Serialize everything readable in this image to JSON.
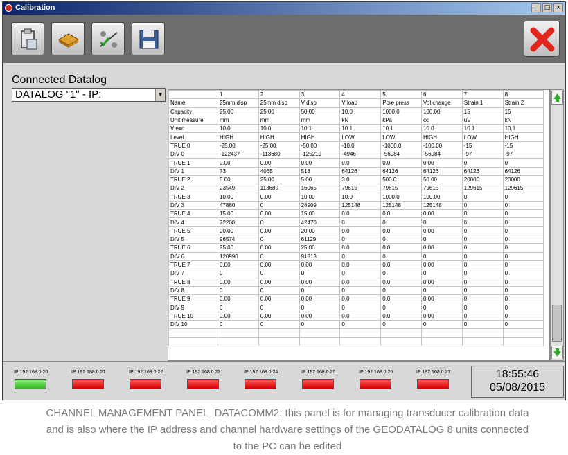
{
  "window": {
    "title": "Calibration",
    "buttons": [
      "_",
      "□",
      "×"
    ]
  },
  "toolbar": {
    "icons": [
      "clipboard-icon",
      "chip-icon",
      "network-icon",
      "floppy-disk-icon"
    ],
    "close_icon": "red-x-icon"
  },
  "connected": {
    "label": "Connected Datalog",
    "selected": "DATALOG \"1\" - IP:"
  },
  "grid": {
    "header": [
      "",
      "1",
      "2",
      "3",
      "4",
      "5",
      "6",
      "7",
      "8"
    ],
    "rows": [
      [
        "Name",
        "25mm disp",
        "25mm disp",
        "V disp",
        "V load",
        "Pore press",
        "Vol change",
        "Strain 1",
        "Strain 2"
      ],
      [
        "Capacity",
        "25.00",
        "25.00",
        "50.00",
        "10.0",
        "1000.0",
        "100.00",
        "15",
        "15"
      ],
      [
        "Unit measure",
        "mm",
        "mm",
        "mm",
        "kN",
        "kPa",
        "cc",
        "uV",
        "kN"
      ],
      [
        "V exc",
        "10.0",
        "10.0",
        "10.1",
        "10.1",
        "10.1",
        "10.0",
        "10.1",
        "10.1"
      ],
      [
        "Level",
        "HIGH",
        "HIGH",
        "HIGH",
        "LOW",
        "LOW",
        "HIGH",
        "LOW",
        "HIGH"
      ],
      [
        "TRUE 0",
        "-25.00",
        "-25.00",
        "-50.00",
        "-10.0",
        "-1000.0",
        "-100.00",
        "-15",
        "-15"
      ],
      [
        "DIV 0",
        "-122437",
        "-113680",
        "-125219",
        "-4946",
        "-56984",
        "-56984",
        "-97",
        "-97"
      ],
      [
        "TRUE 1",
        "0.00",
        "0.00",
        "0.00",
        "0.0",
        "0.0",
        "0.00",
        "0",
        "0"
      ],
      [
        "DIV 1",
        "73",
        "4065",
        "518",
        "64126",
        "64126",
        "64126",
        "64126",
        "64126"
      ],
      [
        "TRUE 2",
        "5.00",
        "25.00",
        "5.00",
        "3.0",
        "500.0",
        "50.00",
        "20000",
        "20000"
      ],
      [
        "DIV 2",
        "23549",
        "113680",
        "16065",
        "79615",
        "79615",
        "79615",
        "129615",
        "129615"
      ],
      [
        "TRUE 3",
        "10.00",
        "0.00",
        "10.00",
        "10.0",
        "1000.0",
        "100.00",
        "0",
        "0"
      ],
      [
        "DIV 3",
        "47880",
        "0",
        "28909",
        "125148",
        "125148",
        "125148",
        "0",
        "0"
      ],
      [
        "TRUE 4",
        "15.00",
        "0.00",
        "15.00",
        "0.0",
        "0.0",
        "0.00",
        "0",
        "0"
      ],
      [
        "DIV 4",
        "72200",
        "0",
        "42470",
        "0",
        "0",
        "0",
        "0",
        "0"
      ],
      [
        "TRUE 5",
        "20.00",
        "0.00",
        "20.00",
        "0.0",
        "0.0",
        "0.00",
        "0",
        "0"
      ],
      [
        "DIV 5",
        "96574",
        "0",
        "61129",
        "0",
        "0",
        "0",
        "0",
        "0"
      ],
      [
        "TRUE 6",
        "25.00",
        "0.00",
        "25.00",
        "0.0",
        "0.0",
        "0.00",
        "0",
        "0"
      ],
      [
        "DIV 6",
        "120990",
        "0",
        "91813",
        "0",
        "0",
        "0",
        "0",
        "0"
      ],
      [
        "TRUE 7",
        "0.00",
        "0.00",
        "0.00",
        "0.0",
        "0.0",
        "0.00",
        "0",
        "0"
      ],
      [
        "DIV 7",
        "0",
        "0",
        "0",
        "0",
        "0",
        "0",
        "0",
        "0"
      ],
      [
        "TRUE 8",
        "0.00",
        "0.00",
        "0.00",
        "0.0",
        "0.0",
        "0.00",
        "0",
        "0"
      ],
      [
        "DIV 8",
        "0",
        "0",
        "0",
        "0",
        "0",
        "0",
        "0",
        "0"
      ],
      [
        "TRUE 9",
        "0.00",
        "0.00",
        "0.00",
        "0.0",
        "0.0",
        "0.00",
        "0",
        "0"
      ],
      [
        "DIV 9",
        "0",
        "0",
        "0",
        "0",
        "0",
        "0",
        "0",
        "0"
      ],
      [
        "TRUE 10",
        "0.00",
        "0.00",
        "0.00",
        "0.0",
        "0.0",
        "0.00",
        "0",
        "0"
      ],
      [
        "DIV 10",
        "0",
        "0",
        "0",
        "0",
        "0",
        "0",
        "0",
        "0"
      ],
      [
        "",
        "",
        "",
        "",
        "",
        "",
        "",
        "",
        ""
      ],
      [
        "",
        "",
        "",
        "",
        "",
        "",
        "",
        "",
        ""
      ]
    ]
  },
  "status": {
    "ips": [
      {
        "label": "IP 192.168.0.20",
        "state": "green"
      },
      {
        "label": "IP 192.168.0.21",
        "state": "red"
      },
      {
        "label": "IP 192.168.0.22",
        "state": "red"
      },
      {
        "label": "IP 192.168.0.23",
        "state": "red"
      },
      {
        "label": "IP 192.168.0.24",
        "state": "red"
      },
      {
        "label": "IP 192.168.0.25",
        "state": "red"
      },
      {
        "label": "IP 192.168.0.26",
        "state": "red"
      },
      {
        "label": "IP 192.168.0.27",
        "state": "red"
      }
    ],
    "time": "18:55:46",
    "date": "05/08/2015"
  },
  "caption": "CHANNEL MANAGEMENT PANEL_DATACOMM2: this panel is for managing transducer calibration data and is also where the IP address and channel hardware settings of the GEODATALOG 8 units connected to the PC can be edited",
  "colors": {
    "led_green": "#34b81e",
    "led_red": "#d60000",
    "close_red": "#e0261c"
  }
}
